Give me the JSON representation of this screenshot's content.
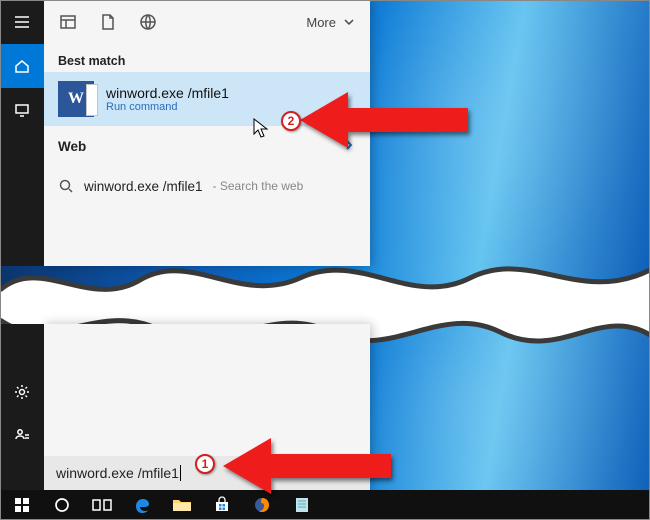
{
  "header": {
    "more_label": "More"
  },
  "sections": {
    "best_match_label": "Best match",
    "web_label": "Web"
  },
  "best_match": {
    "icon_letter": "W",
    "title": "winword.exe /mfile1",
    "subtitle": "Run command"
  },
  "web_result": {
    "title": "winword.exe /mfile1",
    "suffix": " - Search the web"
  },
  "search": {
    "value": "winword.exe /mfile1"
  },
  "steps": {
    "one": "1",
    "two": "2"
  },
  "colors": {
    "accent": "#0078d7",
    "word": "#2b579a",
    "arrow": "#ef1c1c"
  }
}
